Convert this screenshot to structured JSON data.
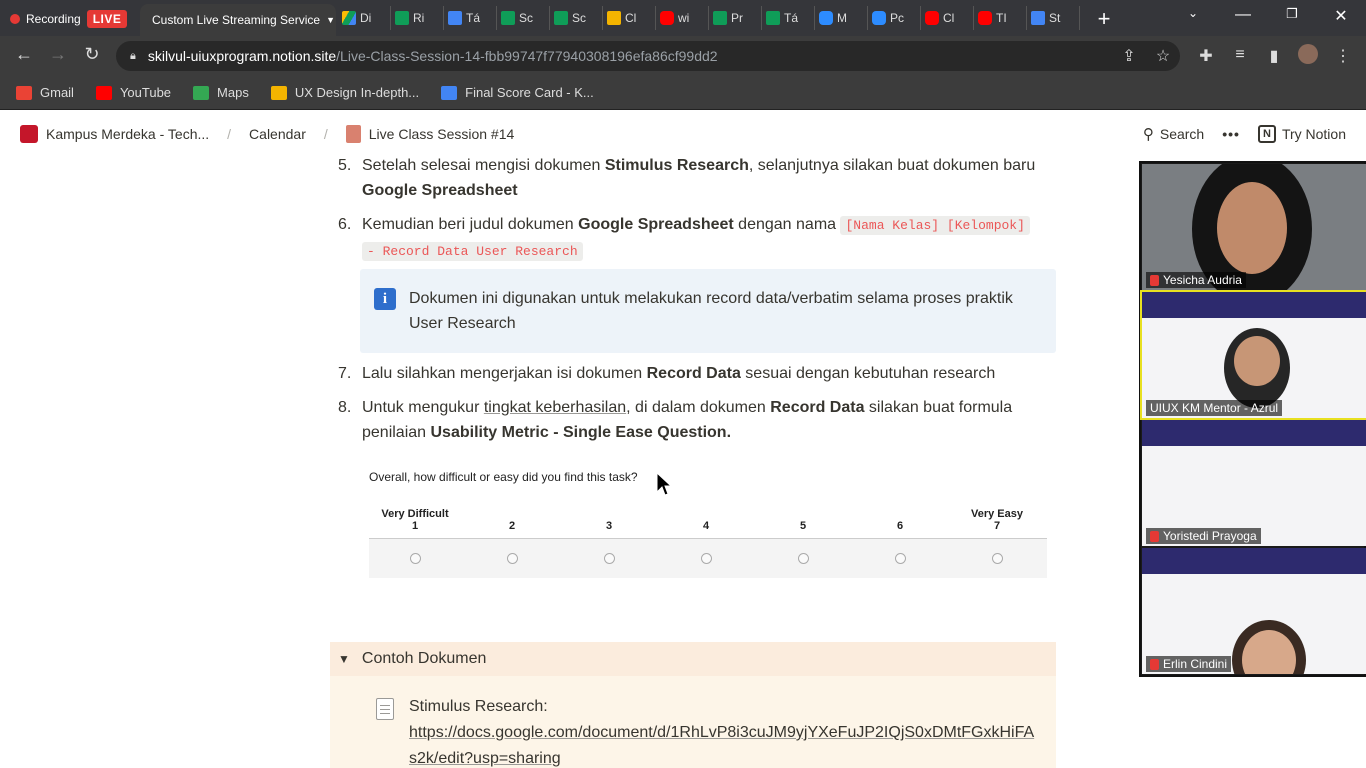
{
  "browser": {
    "recording_label": "Recording",
    "live_badge": "LIVE",
    "active_tab": "Custom Live Streaming Service",
    "tabs": [
      {
        "icon": "drive-icon",
        "label": "Di"
      },
      {
        "icon": "sheets-icon",
        "label": "Ri"
      },
      {
        "icon": "docs-icon",
        "label": "Tá"
      },
      {
        "icon": "sheets-icon",
        "label": "Sc"
      },
      {
        "icon": "sheets-icon",
        "label": "Sc"
      },
      {
        "icon": "slides-icon",
        "label": "Cl"
      },
      {
        "icon": "youtube-icon",
        "label": "wi"
      },
      {
        "icon": "sheets-icon",
        "label": "Pr"
      },
      {
        "icon": "sheets-icon",
        "label": "Tá"
      },
      {
        "icon": "zoom-icon",
        "label": "M"
      },
      {
        "icon": "zoom-icon",
        "label": "Pc"
      },
      {
        "icon": "youtube-icon",
        "label": "Cl"
      },
      {
        "icon": "youtube-icon",
        "label": "TI"
      },
      {
        "icon": "docs-icon",
        "label": "St"
      }
    ],
    "url_host": "skilvul-uiuxprogram.notion.site",
    "url_path": "/Live-Class-Session-14-fbb99747f77940308196efa86cf99dd2",
    "bookmarks": [
      {
        "icon": "gmail-icon",
        "label": "Gmail",
        "color": "#ea4335"
      },
      {
        "icon": "youtube-icon",
        "label": "YouTube",
        "color": "#ff0000"
      },
      {
        "icon": "maps-icon",
        "label": "Maps",
        "color": "#34a853"
      },
      {
        "icon": "folder-icon",
        "label": "UX Design In-depth...",
        "color": "#f4b400"
      },
      {
        "icon": "drive-icon",
        "label": "Final Score Card - K...",
        "color": "#4285f4"
      }
    ]
  },
  "notion": {
    "breadcrumb": [
      "Kampus Merdeka - Tech...",
      "Calendar",
      "Live Class Session #14"
    ],
    "search_label": "Search",
    "more_label": "•••",
    "try_label": "Try Notion"
  },
  "content": {
    "item5": {
      "num": "5.",
      "pre": "Setelah selesai mengisi dokumen ",
      "b1": "Stimulus Research",
      "mid": ", selanjutnya silakan buat dokumen baru ",
      "b2": "Google Spreadsheet"
    },
    "item6": {
      "num": "6.",
      "pre": "Kemudian beri judul dokumen ",
      "b1": "Google Spreadsheet",
      "mid": " dengan nama ",
      "code1": "[Nama Kelas] [Kelompok]",
      "code2": "- Record Data User Research"
    },
    "callout": "Dokumen ini digunakan untuk melakukan record data/verbatim selama proses praktik User Research",
    "item7": {
      "num": "7.",
      "pre": "Lalu silahkan mengerjakan isi dokumen ",
      "b1": "Record Data",
      "post": " sesuai dengan kebutuhan research"
    },
    "item8": {
      "num": "8.",
      "pre": "Untuk mengukur ",
      "link": "tingkat keberhasilan",
      "mid": ", di dalam dokumen ",
      "b1": "Record Data",
      "mid2": " silakan buat formula penilaian ",
      "b2": "Usability Metric - Single Ease Question."
    },
    "survey": {
      "question": "Overall, how difficult or easy did you find this task?",
      "low_label": "Very Difficult",
      "high_label": "Very Easy",
      "scale": [
        "1",
        "2",
        "3",
        "4",
        "5",
        "6",
        "7"
      ]
    },
    "toggle": {
      "title": "Contoh Dokumen",
      "item_label": "Stimulus Research:",
      "item_link": "https://docs.google.com/document/d/1RhLvP8i3cuJM9yjYXeFuJP2IQjS0xDMtFGxkHiFAs2k/edit?usp=sharing"
    }
  },
  "participants": [
    {
      "name": "Yesicha Audria",
      "muted": true
    },
    {
      "name": "UIUX KM Mentor - Azrul",
      "muted": false
    },
    {
      "name": "Yoristedi Prayoga",
      "muted": true
    },
    {
      "name": "Erlin Cindini",
      "muted": true
    }
  ]
}
